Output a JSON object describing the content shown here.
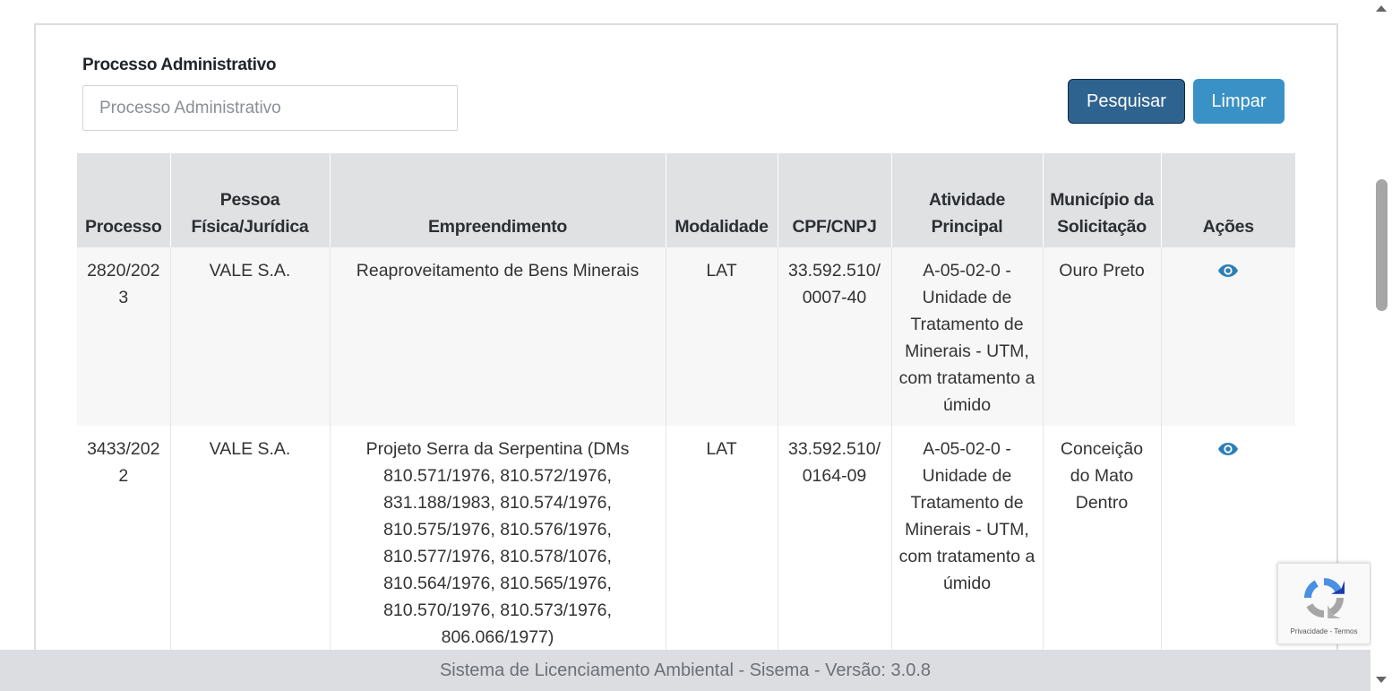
{
  "search": {
    "label": "Processo Administrativo",
    "placeholder": "Processo Administrativo",
    "value": ""
  },
  "buttons": {
    "search": "Pesquisar",
    "clear": "Limpar"
  },
  "table": {
    "headers": {
      "processo": "Processo",
      "pessoa": "Pessoa Física/Jurídica",
      "empreendimento": "Empreendimento",
      "modalidade": "Modalidade",
      "cpf": "CPF/CNPJ",
      "atividade": "Atividade Principal",
      "municipio": "Município da Solicitação",
      "acoes": "Ações"
    },
    "rows": [
      {
        "processo": "2820/2023",
        "pessoa": "VALE S.A.",
        "empreendimento": "Reaproveitamento de Bens Minerais",
        "modalidade": "LAT",
        "cpf": "33.592.510/0007-40",
        "atividade": "A-05-02-0 - Unidade de Tratamento de Minerais - UTM, com tratamento a úmido",
        "municipio": "Ouro Preto",
        "action_icon": "eye-icon"
      },
      {
        "processo": "3433/2022",
        "pessoa": "VALE S.A.",
        "empreendimento": "Projeto Serra da Serpentina (DMs 810.571/1976, 810.572/1976, 831.188/1983, 810.574/1976, 810.575/1976, 810.576/1976, 810.577/1976, 810.578/1076, 810.564/1976, 810.565/1976, 810.570/1976, 810.573/1976, 806.066/1977)",
        "modalidade": "LAT",
        "cpf": "33.592.510/0164-09",
        "atividade": "A-05-02-0 - Unidade de Tratamento de Minerais - UTM, com tratamento a úmido",
        "municipio": "Conceição do Mato Dentro",
        "action_icon": "eye-icon"
      }
    ]
  },
  "footer": {
    "text": "Sistema de Licenciamento Ambiental - Sisema - Versão: 3.0.8"
  },
  "recaptcha": {
    "links": "Privacidade - Termos"
  },
  "colors": {
    "primary_button": "#2e6390",
    "secondary_button": "#3a91c5",
    "icon": "#2e7fb5",
    "header_bg": "#dfe1e3",
    "footer_bg": "#dcdde0"
  }
}
